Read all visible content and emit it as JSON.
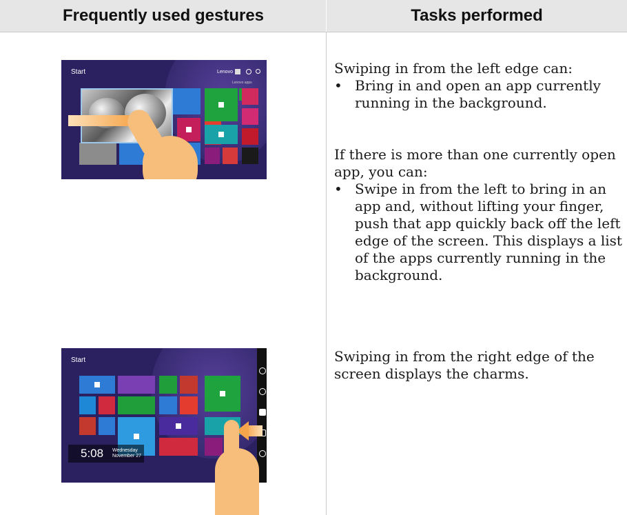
{
  "table": {
    "col1_header": "Frequently used gestures",
    "col2_header": "Tasks performed"
  },
  "row1": {
    "screenshot": {
      "start_label": "Start",
      "user_label": "Lenovo",
      "tile_label": "Lenovo apps"
    },
    "intro": "Swiping in from the left edge can:",
    "bullet": "•",
    "bullet_text": "Bring in and open an app currently running in the background.",
    "intro2": "If there is more than one currently open app, you can:",
    "bullet2": "•",
    "bullet2_text": "Swipe in from the left to bring in an app and, without lifting your finger, push that app quickly back off the left edge of the screen. This displays a list of the apps currently running in the background."
  },
  "row2": {
    "screenshot": {
      "start_label": "Start",
      "time": "5:08",
      "day": "Wednesday",
      "date": "November 27"
    },
    "text": "Swiping in from the right edge of the screen displays the charms."
  },
  "colors": {
    "header_bg": "#e6e6e6",
    "start_screen": "#2b2160",
    "finger": "#f6bd7b",
    "arrow": "#f5a54b"
  }
}
